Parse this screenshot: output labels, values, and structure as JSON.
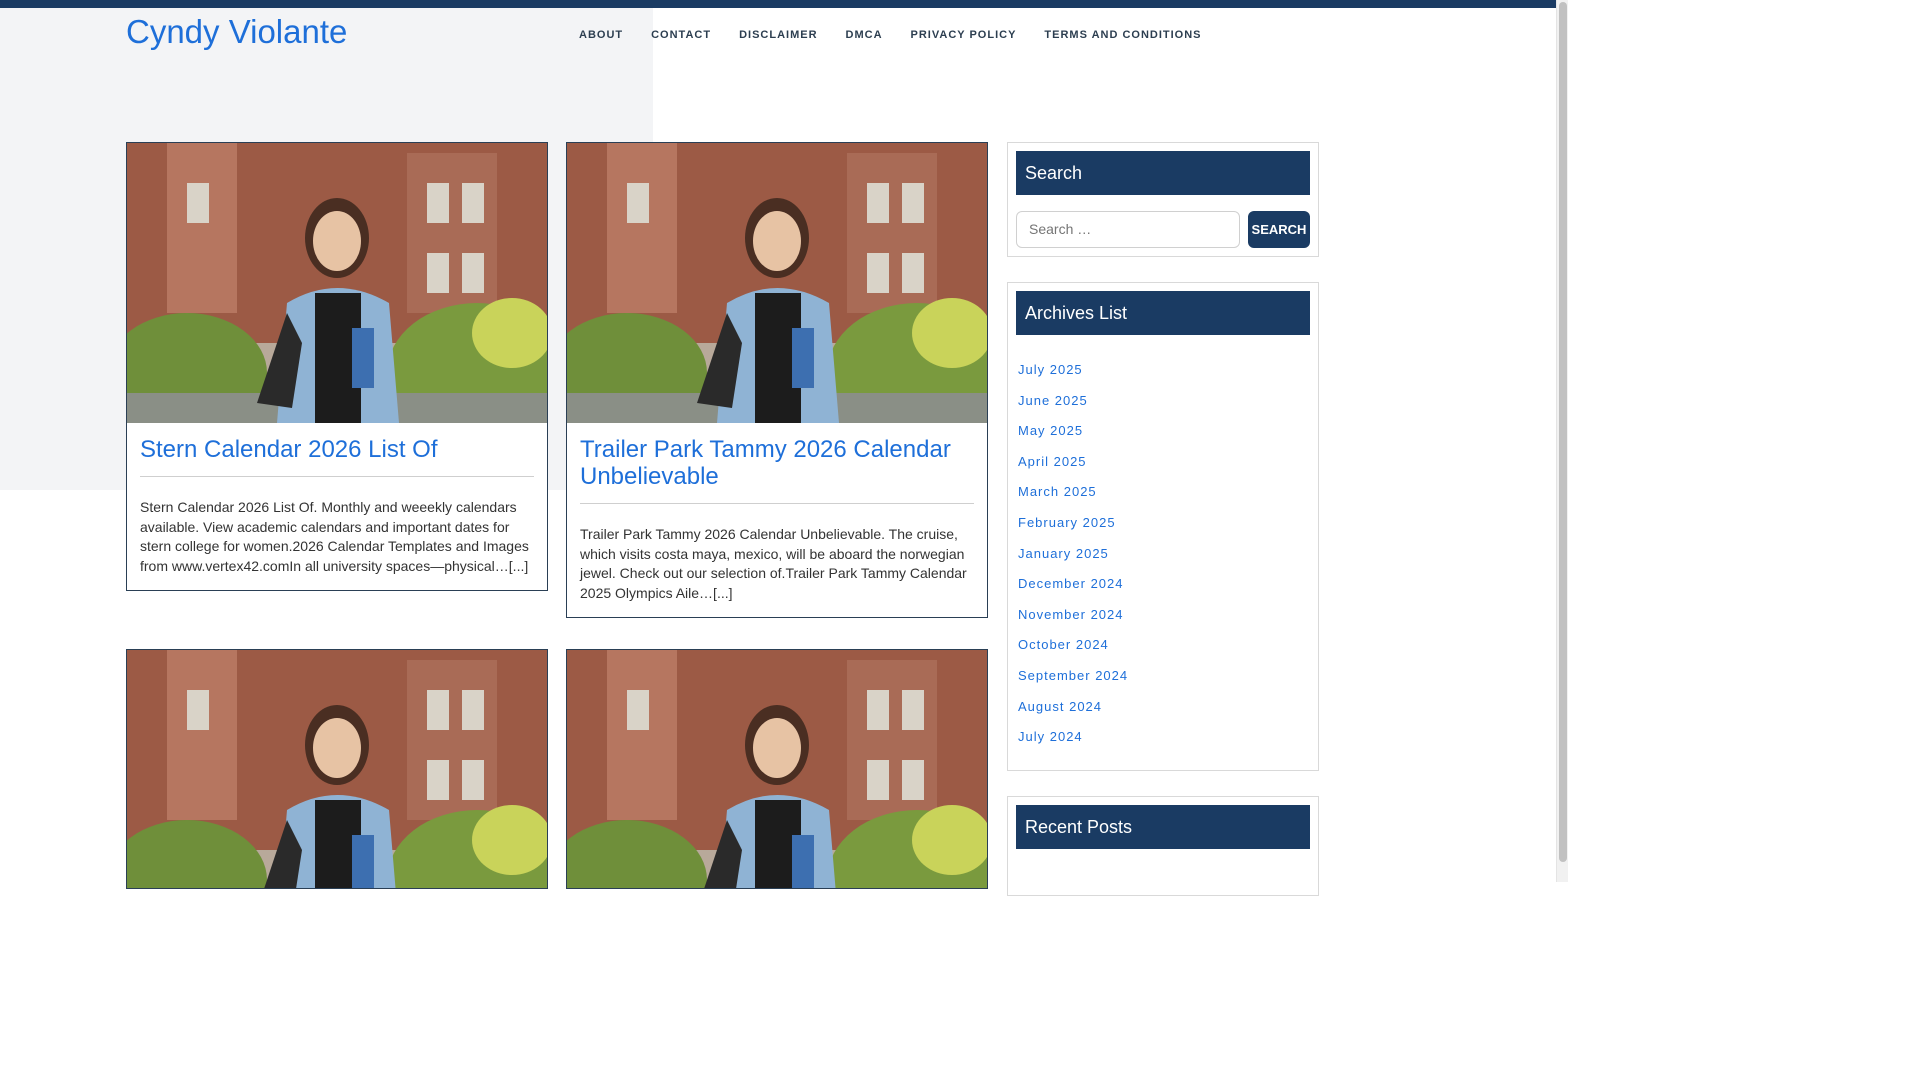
{
  "site": {
    "title": "Cyndy Violante"
  },
  "nav": [
    "ABOUT",
    "CONTACT",
    "DISCLAIMER",
    "DMCA",
    "PRIVACY POLICY",
    "TERMS AND CONDITIONS"
  ],
  "posts": [
    {
      "title": "Stern Calendar 2026 List Of",
      "excerpt": "Stern Calendar 2026 List Of. Monthly and weeekly calendars available. View academic calendars and important dates for stern college for women.2026 Calendar Templates and Images from www.vertex42.comIn all university spaces—physical…[...]"
    },
    {
      "title": "Trailer Park Tammy 2026 Calendar Unbelievable",
      "excerpt": "Trailer Park Tammy 2026 Calendar Unbelievable. The cruise, which visits costa maya, mexico, will be aboard the norwegian jewel. Check out our selection of.Trailer Park Tammy Calendar 2025 Olympics Aile…[...]"
    },
    {
      "title": "",
      "excerpt": ""
    },
    {
      "title": "",
      "excerpt": ""
    }
  ],
  "sidebar": {
    "search": {
      "title": "Search",
      "placeholder": "Search …",
      "button": "SEARCH"
    },
    "archives": {
      "title": "Archives List",
      "items": [
        "July 2025",
        "June 2025",
        "May 2025",
        "April 2025",
        "March 2025",
        "February 2025",
        "January 2025",
        "December 2024",
        "November 2024",
        "October 2024",
        "September 2024",
        "August 2024",
        "July 2024"
      ]
    },
    "recent": {
      "title": "Recent Posts"
    }
  },
  "colors": {
    "accent": "#1e6fd9",
    "dark": "#1a3b63"
  }
}
